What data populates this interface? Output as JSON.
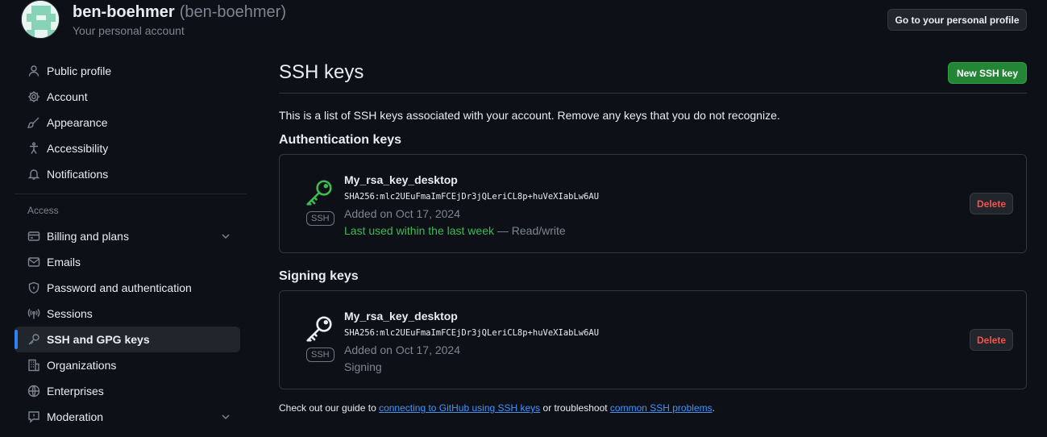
{
  "user": {
    "name": "ben-boehmer",
    "handle": "(ben-boehmer)",
    "subtitle": "Your personal account",
    "profile_button": "Go to your personal profile"
  },
  "sidebar": {
    "items_top": [
      {
        "label": "Public profile",
        "icon": "person-icon"
      },
      {
        "label": "Account",
        "icon": "gear-icon"
      },
      {
        "label": "Appearance",
        "icon": "paintbrush-icon"
      },
      {
        "label": "Accessibility",
        "icon": "accessibility-icon"
      },
      {
        "label": "Notifications",
        "icon": "bell-icon"
      }
    ],
    "access_heading": "Access",
    "items_access": [
      {
        "label": "Billing and plans",
        "icon": "credit-card-icon"
      },
      {
        "label": "Emails",
        "icon": "mail-icon"
      },
      {
        "label": "Password and authentication",
        "icon": "shield-lock-icon"
      },
      {
        "label": "Sessions",
        "icon": "broadcast-icon"
      },
      {
        "label": "SSH and GPG keys",
        "icon": "key-icon"
      },
      {
        "label": "Organizations",
        "icon": "organization-icon"
      },
      {
        "label": "Enterprises",
        "icon": "globe-icon"
      },
      {
        "label": "Moderation",
        "icon": "report-icon"
      }
    ]
  },
  "main": {
    "title": "SSH keys",
    "new_button": "New SSH key",
    "intro": "This is a list of SSH keys associated with your account. Remove any keys that you do not recognize.",
    "auth_heading": "Authentication keys",
    "auth_key": {
      "name": "My_rsa_key_desktop",
      "fingerprint": "SHA256:mlc2UEuFmaImFCEjDr3jQLeriCL8p+huVeXIabLw6AU",
      "added": "Added on Oct 17, 2024",
      "last_used": "Last used within the last week",
      "access": " — Read/write",
      "badge": "SSH",
      "delete": "Delete",
      "icon_color": "#3fb950"
    },
    "signing_heading": "Signing keys",
    "signing_key": {
      "name": "My_rsa_key_desktop",
      "fingerprint": "SHA256:mlc2UEuFmaImFCEjDr3jQLeriCL8p+huVeXIabLw6AU",
      "added": "Added on Oct 17, 2024",
      "usage": "Signing",
      "badge": "SSH",
      "delete": "Delete",
      "icon_color": "#e6edf3"
    },
    "footer": {
      "prefix": "Check out our guide to ",
      "link1": "connecting to GitHub using SSH keys",
      "middle": " or troubleshoot ",
      "link2": "common SSH problems",
      "suffix": "."
    }
  },
  "colors": {
    "accent": "#2f81f7",
    "primary_button": "#238636",
    "danger": "#f85149",
    "success": "#3fb950"
  }
}
